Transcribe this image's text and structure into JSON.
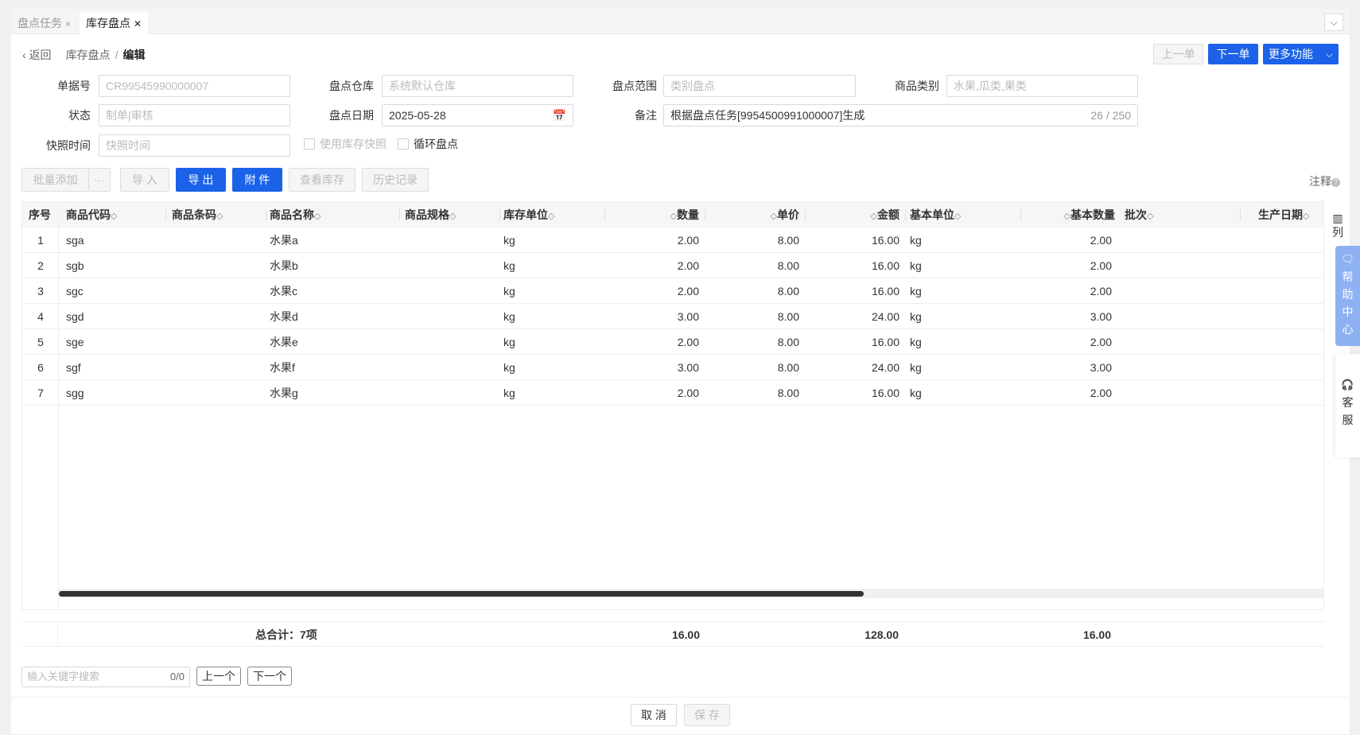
{
  "tabs": [
    {
      "label": "盘点任务",
      "close": "×",
      "active": false
    },
    {
      "label": "库存盘点",
      "close": "✕",
      "active": true
    }
  ],
  "tab_dropdown": "⌵",
  "breadcrumb": {
    "back": "返回",
    "section": "库存盘点",
    "sep": "/",
    "current": "编辑"
  },
  "top_buttons": {
    "prev": "上一单",
    "next": "下一单",
    "more": "更多功能"
  },
  "form": {
    "doc_no": {
      "label": "单据号",
      "placeholder": "CR99545990000007"
    },
    "warehouse": {
      "label": "盘点仓库",
      "placeholder": "系统默认仓库"
    },
    "range": {
      "label": "盘点范围",
      "placeholder": "类别盘点"
    },
    "category": {
      "label": "商品类别",
      "placeholder": "水果,瓜类,果类"
    },
    "status": {
      "label": "状态",
      "placeholder": "制单|审核"
    },
    "date": {
      "label": "盘点日期",
      "value": "2025-05-28"
    },
    "remark": {
      "label": "备注",
      "value": "根据盘点任务[9954500991000007]生成",
      "count": "26 / 250"
    },
    "snapshot_time": {
      "label": "快照时间",
      "placeholder": "快照时间"
    },
    "use_snapshot": {
      "label": "使用库存快照",
      "checked": false
    },
    "cycle_count": {
      "label": "循环盘点",
      "checked": false
    }
  },
  "toolbar": {
    "batch_add": "批量添加",
    "more": "···",
    "import": "导 入",
    "export": "导 出",
    "attach": "附 件",
    "view_stock": "查看库存",
    "history": "历史记录",
    "notes": "注释",
    "notes_q": "?"
  },
  "columns": [
    "序号",
    "商品代码",
    "商品条码",
    "商品名称",
    "商品规格",
    "库存单位",
    "数量",
    "单价",
    "金额",
    "基本单位",
    "基本数量",
    "批次",
    "生产日期"
  ],
  "sort_glyph": "◇",
  "rows": [
    {
      "idx": "1",
      "code": "sga",
      "name": "水果a",
      "unit": "kg",
      "qty": "2.00",
      "price": "8.00",
      "amount": "16.00",
      "base_unit": "kg",
      "base_qty": "2.00"
    },
    {
      "idx": "2",
      "code": "sgb",
      "name": "水果b",
      "unit": "kg",
      "qty": "2.00",
      "price": "8.00",
      "amount": "16.00",
      "base_unit": "kg",
      "base_qty": "2.00"
    },
    {
      "idx": "3",
      "code": "sgc",
      "name": "水果c",
      "unit": "kg",
      "qty": "2.00",
      "price": "8.00",
      "amount": "16.00",
      "base_unit": "kg",
      "base_qty": "2.00"
    },
    {
      "idx": "4",
      "code": "sgd",
      "name": "水果d",
      "unit": "kg",
      "qty": "3.00",
      "price": "8.00",
      "amount": "24.00",
      "base_unit": "kg",
      "base_qty": "3.00"
    },
    {
      "idx": "5",
      "code": "sge",
      "name": "水果e",
      "unit": "kg",
      "qty": "2.00",
      "price": "8.00",
      "amount": "16.00",
      "base_unit": "kg",
      "base_qty": "2.00"
    },
    {
      "idx": "6",
      "code": "sgf",
      "name": "水果f",
      "unit": "kg",
      "qty": "3.00",
      "price": "8.00",
      "amount": "24.00",
      "base_unit": "kg",
      "base_qty": "3.00"
    },
    {
      "idx": "7",
      "code": "sgg",
      "name": "水果g",
      "unit": "kg",
      "qty": "2.00",
      "price": "8.00",
      "amount": "16.00",
      "base_unit": "kg",
      "base_qty": "2.00"
    }
  ],
  "column_settings": {
    "icon": "▥",
    "label": "列"
  },
  "totals": {
    "label": "总合计：7项",
    "qty": "16.00",
    "amount": "128.00",
    "base_qty": "16.00"
  },
  "search": {
    "placeholder": "输入关键字搜索",
    "count": "0/0",
    "prev": "上一个",
    "next": "下一个"
  },
  "footer": {
    "cancel": "取 消",
    "save": "保 存"
  },
  "side": {
    "help": [
      "帮",
      "助",
      "中",
      "心"
    ],
    "service": [
      "客",
      "服"
    ]
  },
  "colors": {
    "primary": "#1b62e8",
    "help_bg": "#8eb1f3"
  }
}
